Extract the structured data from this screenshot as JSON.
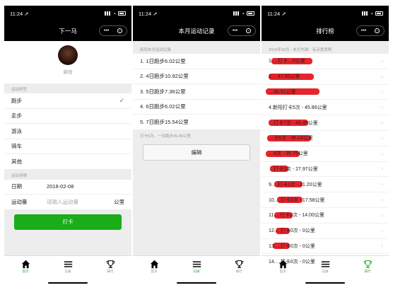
{
  "status": {
    "time": "11:24",
    "arrow": "➚"
  },
  "colors": {
    "accent": "#1aad19",
    "navbar": "#000000",
    "redaction": "#e8232a"
  },
  "tabbar": {
    "tabs": [
      {
        "label": "首页",
        "icon": "home-icon"
      },
      {
        "label": "记录",
        "icon": "list-icon"
      },
      {
        "label": "排行",
        "icon": "trophy-icon"
      }
    ]
  },
  "screen1": {
    "title": "下一马",
    "user_name": "新阳",
    "sport_section": "运动类型",
    "sports": [
      "跑步",
      "走步",
      "游泳",
      "骑车",
      "其他"
    ],
    "selected_sport": "跑步",
    "detail_section": "运动详情",
    "date_label": "日期",
    "date_value": "2018-02-08",
    "amount_label": "运动量",
    "amount_placeholder": "请输入运动量",
    "amount_unit": "公里",
    "submit_label": "打卡"
  },
  "screen2": {
    "title": "本月运动记录",
    "section": "新阳本月运动记录",
    "records": [
      "1. 1日跑步6.02公里",
      "2. 4日跑步10.92公里",
      "3. 5日跑步7.36公里",
      "4. 6日跑步6.02公里",
      "5. 7日跑步15.54公里"
    ],
    "summary": "打卡5次，一共跑步45.86公里",
    "edit_label": "编辑"
  },
  "screen3": {
    "title": "排行榜",
    "section": "2018年02月 - 本月先锋：有点意思啊",
    "rows": [
      "1.…打卡…0公里",
      "2.…47.00公里",
      "…46.51公里",
      "4.新阳打卡5次 - 45.86公里",
      "…打卡7次 - 45.45公里",
      "…卡5次 - 36.14公里",
      "…4次 - 35.75公里",
      "…打卡3次 - 27.97公里",
      "9.…打卡3次 - 21.20公里",
      "10.…打卡3次 - 17.58公里",
      "11.…打卡2次 - 14.00公里",
      "12.…打卡0次 - 0公里",
      "13.…打卡0次 - 0公里",
      "14.…打卡0次 - 0公里"
    ]
  }
}
